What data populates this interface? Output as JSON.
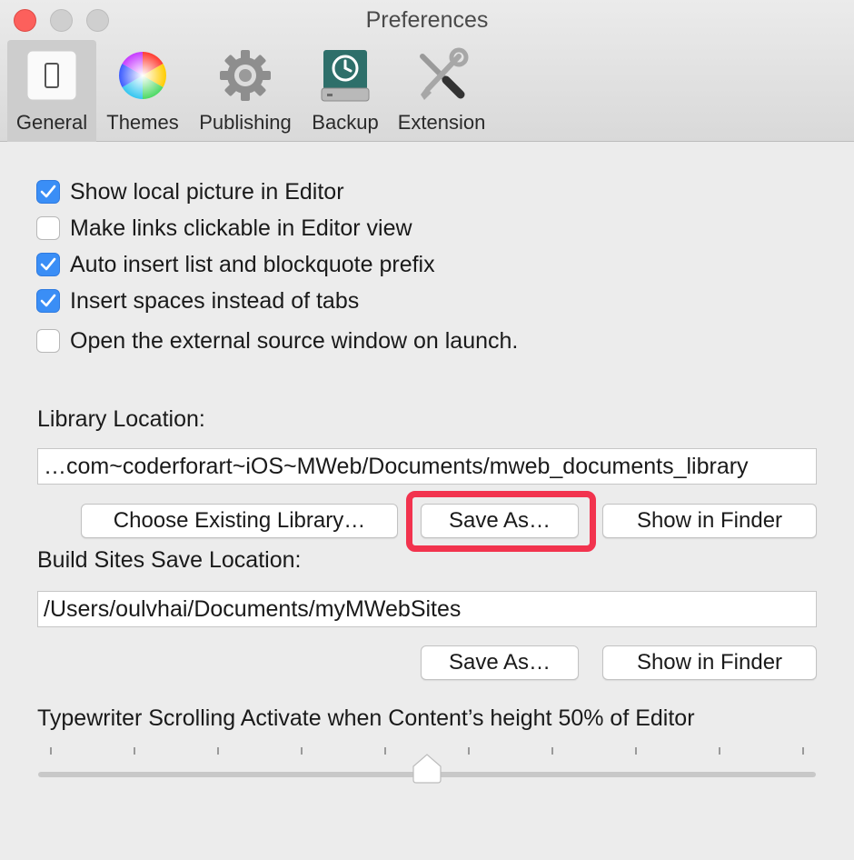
{
  "window": {
    "title": "Preferences"
  },
  "tabs": [
    {
      "label": "General",
      "icon": "general-switch-icon",
      "selected": true
    },
    {
      "label": "Themes",
      "icon": "color-wheel-icon"
    },
    {
      "label": "Publishing",
      "icon": "gear-icon"
    },
    {
      "label": "Backup",
      "icon": "time-machine-drive-icon"
    },
    {
      "label": "Extension",
      "icon": "tools-icon"
    }
  ],
  "options": [
    {
      "label": "Show local picture in Editor",
      "checked": true
    },
    {
      "label": "Make links clickable in Editor view",
      "checked": false
    },
    {
      "label": "Auto insert list and blockquote prefix",
      "checked": true
    },
    {
      "label": "Insert spaces instead of tabs",
      "checked": true
    },
    {
      "label": "Open the external source window on launch.",
      "checked": false
    }
  ],
  "library": {
    "label": "Library Location:",
    "path": "…com~coderforart~iOS~MWeb/Documents/mweb_documents_library",
    "choose_label": "Choose Existing Library…",
    "save_as_label": "Save As…",
    "show_finder_label": "Show in Finder"
  },
  "build_sites": {
    "label": "Build Sites Save Location:",
    "path": "/Users/oulvhai/Documents/myMWebSites",
    "save_as_label": "Save As…",
    "show_finder_label": "Show in Finder"
  },
  "typewriter": {
    "label": "Typewriter Scrolling Activate when Content’s height 50% of Editor",
    "value_fraction": 0.5,
    "tick_count": 10
  },
  "colors": {
    "accent": "#3a8ef6",
    "highlight": "#f2334e",
    "close_button": "#fc605c"
  }
}
